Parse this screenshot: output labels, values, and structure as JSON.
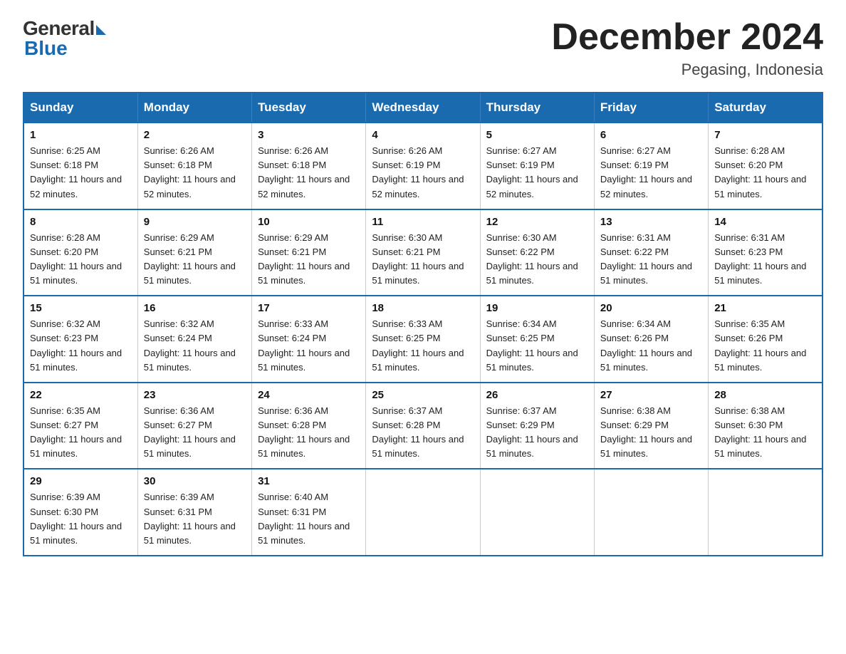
{
  "logo": {
    "general": "General",
    "blue": "Blue"
  },
  "header": {
    "month_year": "December 2024",
    "location": "Pegasing, Indonesia"
  },
  "weekdays": [
    "Sunday",
    "Monday",
    "Tuesday",
    "Wednesday",
    "Thursday",
    "Friday",
    "Saturday"
  ],
  "weeks": [
    [
      {
        "day": "1",
        "sunrise": "6:25 AM",
        "sunset": "6:18 PM",
        "daylight": "11 hours and 52 minutes."
      },
      {
        "day": "2",
        "sunrise": "6:26 AM",
        "sunset": "6:18 PM",
        "daylight": "11 hours and 52 minutes."
      },
      {
        "day": "3",
        "sunrise": "6:26 AM",
        "sunset": "6:18 PM",
        "daylight": "11 hours and 52 minutes."
      },
      {
        "day": "4",
        "sunrise": "6:26 AM",
        "sunset": "6:19 PM",
        "daylight": "11 hours and 52 minutes."
      },
      {
        "day": "5",
        "sunrise": "6:27 AM",
        "sunset": "6:19 PM",
        "daylight": "11 hours and 52 minutes."
      },
      {
        "day": "6",
        "sunrise": "6:27 AM",
        "sunset": "6:19 PM",
        "daylight": "11 hours and 52 minutes."
      },
      {
        "day": "7",
        "sunrise": "6:28 AM",
        "sunset": "6:20 PM",
        "daylight": "11 hours and 51 minutes."
      }
    ],
    [
      {
        "day": "8",
        "sunrise": "6:28 AM",
        "sunset": "6:20 PM",
        "daylight": "11 hours and 51 minutes."
      },
      {
        "day": "9",
        "sunrise": "6:29 AM",
        "sunset": "6:21 PM",
        "daylight": "11 hours and 51 minutes."
      },
      {
        "day": "10",
        "sunrise": "6:29 AM",
        "sunset": "6:21 PM",
        "daylight": "11 hours and 51 minutes."
      },
      {
        "day": "11",
        "sunrise": "6:30 AM",
        "sunset": "6:21 PM",
        "daylight": "11 hours and 51 minutes."
      },
      {
        "day": "12",
        "sunrise": "6:30 AM",
        "sunset": "6:22 PM",
        "daylight": "11 hours and 51 minutes."
      },
      {
        "day": "13",
        "sunrise": "6:31 AM",
        "sunset": "6:22 PM",
        "daylight": "11 hours and 51 minutes."
      },
      {
        "day": "14",
        "sunrise": "6:31 AM",
        "sunset": "6:23 PM",
        "daylight": "11 hours and 51 minutes."
      }
    ],
    [
      {
        "day": "15",
        "sunrise": "6:32 AM",
        "sunset": "6:23 PM",
        "daylight": "11 hours and 51 minutes."
      },
      {
        "day": "16",
        "sunrise": "6:32 AM",
        "sunset": "6:24 PM",
        "daylight": "11 hours and 51 minutes."
      },
      {
        "day": "17",
        "sunrise": "6:33 AM",
        "sunset": "6:24 PM",
        "daylight": "11 hours and 51 minutes."
      },
      {
        "day": "18",
        "sunrise": "6:33 AM",
        "sunset": "6:25 PM",
        "daylight": "11 hours and 51 minutes."
      },
      {
        "day": "19",
        "sunrise": "6:34 AM",
        "sunset": "6:25 PM",
        "daylight": "11 hours and 51 minutes."
      },
      {
        "day": "20",
        "sunrise": "6:34 AM",
        "sunset": "6:26 PM",
        "daylight": "11 hours and 51 minutes."
      },
      {
        "day": "21",
        "sunrise": "6:35 AM",
        "sunset": "6:26 PM",
        "daylight": "11 hours and 51 minutes."
      }
    ],
    [
      {
        "day": "22",
        "sunrise": "6:35 AM",
        "sunset": "6:27 PM",
        "daylight": "11 hours and 51 minutes."
      },
      {
        "day": "23",
        "sunrise": "6:36 AM",
        "sunset": "6:27 PM",
        "daylight": "11 hours and 51 minutes."
      },
      {
        "day": "24",
        "sunrise": "6:36 AM",
        "sunset": "6:28 PM",
        "daylight": "11 hours and 51 minutes."
      },
      {
        "day": "25",
        "sunrise": "6:37 AM",
        "sunset": "6:28 PM",
        "daylight": "11 hours and 51 minutes."
      },
      {
        "day": "26",
        "sunrise": "6:37 AM",
        "sunset": "6:29 PM",
        "daylight": "11 hours and 51 minutes."
      },
      {
        "day": "27",
        "sunrise": "6:38 AM",
        "sunset": "6:29 PM",
        "daylight": "11 hours and 51 minutes."
      },
      {
        "day": "28",
        "sunrise": "6:38 AM",
        "sunset": "6:30 PM",
        "daylight": "11 hours and 51 minutes."
      }
    ],
    [
      {
        "day": "29",
        "sunrise": "6:39 AM",
        "sunset": "6:30 PM",
        "daylight": "11 hours and 51 minutes."
      },
      {
        "day": "30",
        "sunrise": "6:39 AM",
        "sunset": "6:31 PM",
        "daylight": "11 hours and 51 minutes."
      },
      {
        "day": "31",
        "sunrise": "6:40 AM",
        "sunset": "6:31 PM",
        "daylight": "11 hours and 51 minutes."
      },
      null,
      null,
      null,
      null
    ]
  ],
  "labels": {
    "sunrise": "Sunrise:",
    "sunset": "Sunset:",
    "daylight": "Daylight:"
  }
}
